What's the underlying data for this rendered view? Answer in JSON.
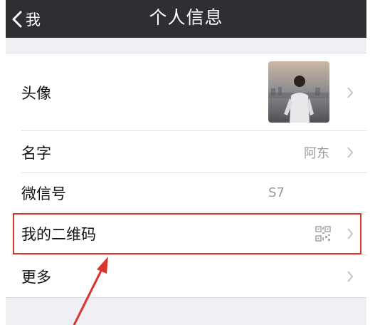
{
  "navbar": {
    "back_label": "我",
    "title": "个人信息"
  },
  "rows": {
    "avatar": {
      "label": "头像"
    },
    "name": {
      "label": "名字",
      "value": "阿东"
    },
    "wechat_id": {
      "label": "微信号",
      "value": "S7"
    },
    "qr_code": {
      "label": "我的二维码"
    },
    "more": {
      "label": "更多"
    }
  },
  "colors": {
    "navbar_bg": "#2f2f33",
    "page_bg": "#efeff4",
    "highlight": "#d9352b",
    "secondary_text": "#9a9a9a"
  }
}
